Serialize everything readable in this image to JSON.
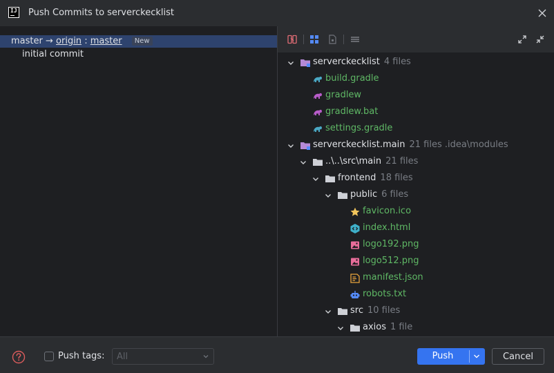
{
  "window": {
    "title": "Push Commits to serverckecklist"
  },
  "commits": {
    "branch": {
      "local": "master",
      "remote": "origin",
      "separator": ":",
      "remote_branch": "master",
      "badge": "New"
    },
    "items": [
      {
        "message": "initial commit"
      }
    ]
  },
  "tree": [
    {
      "label": "serverckecklist",
      "count": "4 files",
      "kind": "module"
    },
    {
      "label": "build.gradle",
      "kind": "gradle"
    },
    {
      "label": "gradlew",
      "kind": "gradlew"
    },
    {
      "label": "gradlew.bat",
      "kind": "gradlew"
    },
    {
      "label": "settings.gradle",
      "kind": "gradle"
    },
    {
      "label": "serverckecklist.main",
      "count": "21 files .idea\\modules",
      "kind": "module"
    },
    {
      "label": "..\\..\\src\\main",
      "count": "21 files",
      "kind": "folder"
    },
    {
      "label": "frontend",
      "count": "18 files",
      "kind": "folder"
    },
    {
      "label": "public",
      "count": "6 files",
      "kind": "folder"
    },
    {
      "label": "favicon.ico",
      "kind": "favicon"
    },
    {
      "label": "index.html",
      "kind": "html"
    },
    {
      "label": "logo192.png",
      "kind": "image"
    },
    {
      "label": "logo512.png",
      "kind": "image"
    },
    {
      "label": "manifest.json",
      "kind": "json"
    },
    {
      "label": "robots.txt",
      "kind": "robots"
    },
    {
      "label": "src",
      "count": "10 files",
      "kind": "folder"
    },
    {
      "label": "axios",
      "count": "1 file",
      "kind": "folder"
    }
  ],
  "footer": {
    "push_tags_label": "Push tags:",
    "push_tags_value": "All",
    "push_label": "Push",
    "cancel_label": "Cancel"
  },
  "colors": {
    "accent": "#3574f0",
    "selection": "#2e436e",
    "file_added": "#5fb865",
    "help": "#db5c5c"
  }
}
